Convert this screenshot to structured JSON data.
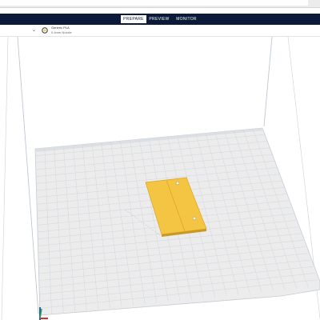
{
  "stage_tabs": [
    {
      "label": "PREPARE",
      "active": true
    },
    {
      "label": "PREVIEW",
      "active": false
    },
    {
      "label": "MONITOR",
      "active": false
    }
  ],
  "printer": {
    "name": "Generic PLA",
    "subtitle": "0.4mm Nozzle"
  },
  "colors": {
    "stage_bar": "#0c1a3a",
    "build_plate": "#ededed",
    "grid_line": "#d2d6dc",
    "model": "#f4c542",
    "axis_x": "#d32f2f",
    "axis_y": "#2aa34a",
    "axis_z": "#1e5bd6"
  }
}
